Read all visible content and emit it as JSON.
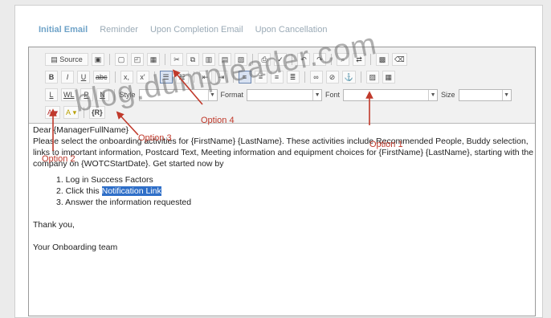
{
  "tabs": [
    "Initial Email",
    "Reminder",
    "Upon Completion Email",
    "Upon Cancellation"
  ],
  "toolbar": {
    "source_label": "Source",
    "style_label": "Style",
    "format_label": "Format",
    "font_label": "Font",
    "size_label": "Size",
    "bold": "B",
    "italic": "I",
    "underline": "U",
    "strike": "abc",
    "sub": "x,",
    "sup": "x'",
    "row3_buttons": [
      "L",
      "WL",
      "P",
      "N"
    ],
    "row4_buttons": [
      "A",
      "A"
    ],
    "field_btn": "{R}"
  },
  "annotations": {
    "option1": "Option 1",
    "option2": "Option 2",
    "option3": "Option 3",
    "option4": "Option 4",
    "color": "#c0392b"
  },
  "watermark": "blog.dumpleader.com",
  "body": {
    "greeting": "Dear {ManagerFullName}",
    "paragraph": "Please select the onboarding activities for {FirstName} {LastName}. These activities include Recommended People, Buddy selection, links to important information, Postcard Text, Meeting information and equipment choices for {FirstName} {LastName}, starting with the company on {WOTCStartDate}. Get started now by",
    "steps": [
      "1. Log in Success Factors",
      "2. Click this ",
      "3. Answer the information requested"
    ],
    "link_text": "Notification Link",
    "thanks": "Thank you,",
    "signature": "Your Onboarding team"
  }
}
